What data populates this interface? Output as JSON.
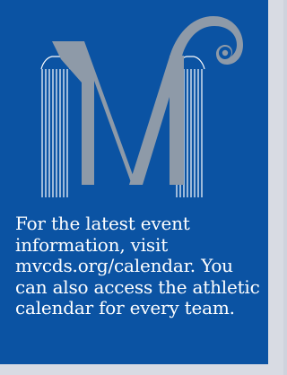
{
  "logo": {
    "letter": "M",
    "letter_color": "#8e9aa8",
    "column_color": "#ffffff",
    "background_color": "#0b53a3"
  },
  "caption": {
    "text": "For the latest event information, visit mvcds.org/calendar. You can also access the athletic calendar for every team."
  }
}
